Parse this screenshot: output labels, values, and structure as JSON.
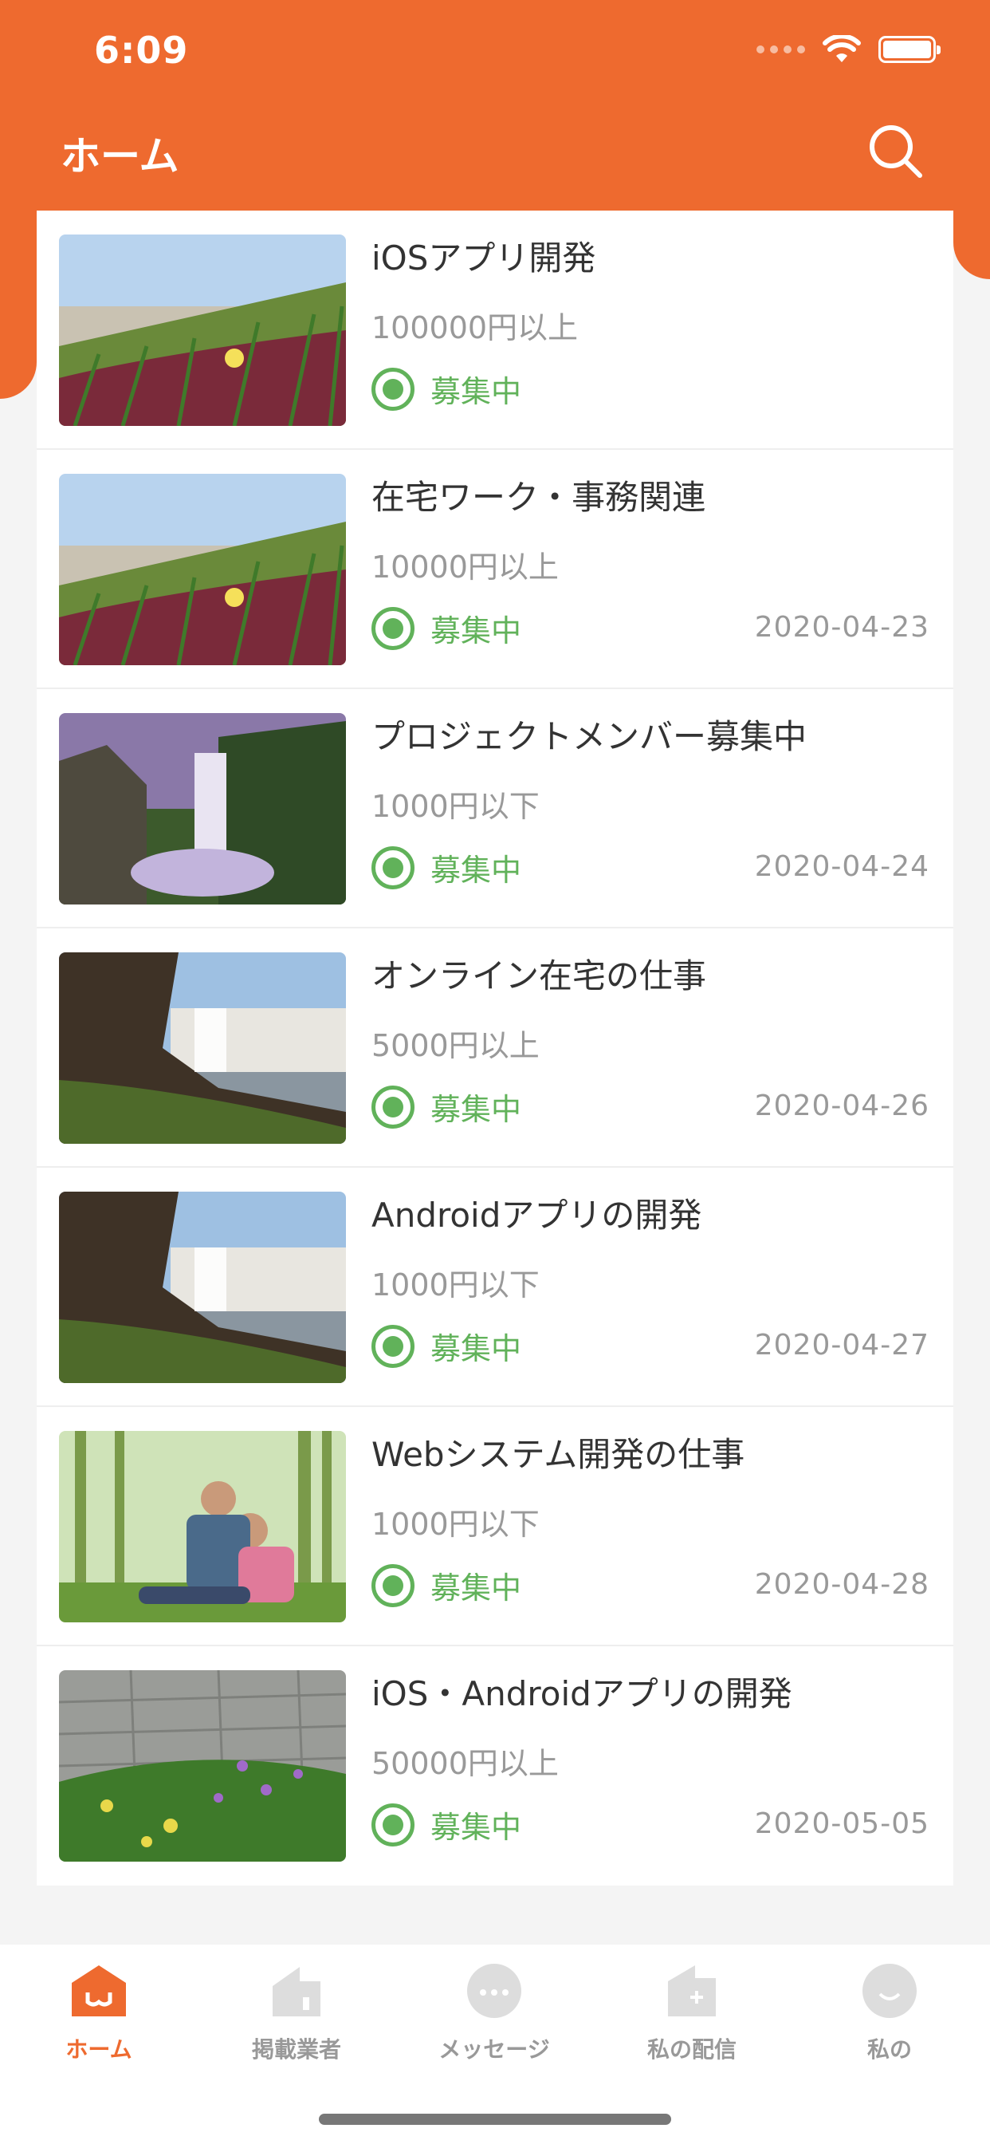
{
  "status_bar": {
    "time": "6:09"
  },
  "nav": {
    "title": "ホーム",
    "search_icon": "search-icon"
  },
  "colors": {
    "accent": "#ee6a2f",
    "status_green": "#61b25a",
    "muted_text": "#999999"
  },
  "items": [
    {
      "title": "iOSアプリ開発",
      "price": "100000円以上",
      "status": "募集中",
      "date": "",
      "image": "meadow-flowers"
    },
    {
      "title": "在宅ワーク・事務関連",
      "price": "10000円以上",
      "status": "募集中",
      "date": "2020-04-23",
      "image": "meadow-flowers"
    },
    {
      "title": "プロジェクトメンバー募集中",
      "price": "1000円以下",
      "status": "募集中",
      "date": "2020-04-24",
      "image": "waterfall-purple"
    },
    {
      "title": "オンライン在宅の仕事",
      "price": "5000円以上",
      "status": "募集中",
      "date": "2020-04-26",
      "image": "waterfall-cliff"
    },
    {
      "title": "Androidアプリの開発",
      "price": "1000円以下",
      "status": "募集中",
      "date": "2020-04-27",
      "image": "waterfall-cliff"
    },
    {
      "title": "Webシステム開発の仕事",
      "price": "1000円以下",
      "status": "募集中",
      "date": "2020-04-28",
      "image": "family-park"
    },
    {
      "title": "iOS・Androidアプリの開発",
      "price": "50000円以上",
      "status": "募集中",
      "date": "2020-05-05",
      "image": "wildflowers-wall"
    }
  ],
  "tabs": [
    {
      "label": "ホーム",
      "icon": "home-icon",
      "active": true
    },
    {
      "label": "掲載業者",
      "icon": "store-icon",
      "active": false
    },
    {
      "label": "メッセージ",
      "icon": "message-icon",
      "active": false
    },
    {
      "label": "私の配信",
      "icon": "post-icon",
      "active": false
    },
    {
      "label": "私の",
      "icon": "profile-icon",
      "active": false
    }
  ]
}
